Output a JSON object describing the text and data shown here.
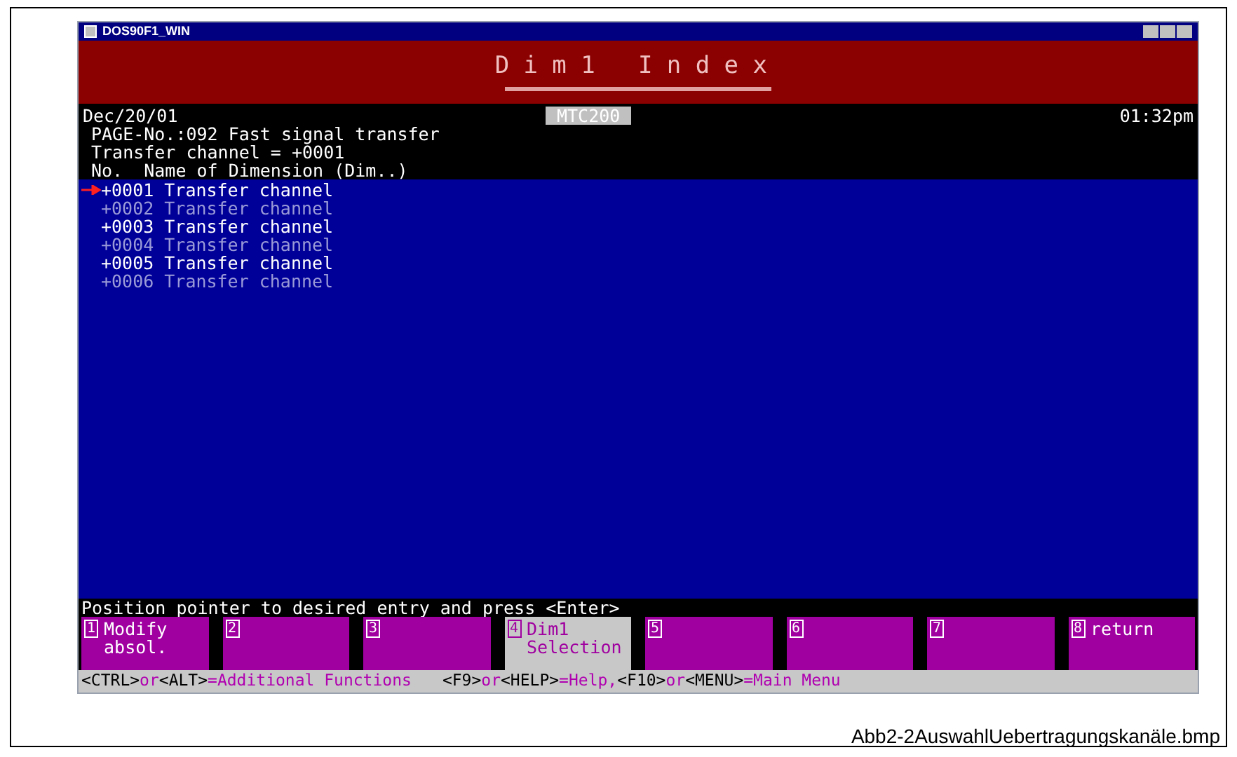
{
  "window": {
    "title": "DOS90F1_WIN"
  },
  "header": {
    "title": "Dim1 Index"
  },
  "info": {
    "date": "Dec/20/01",
    "badge": "MTC200",
    "time": "01:32pm",
    "lines": [
      "PAGE-No.:092 Fast signal transfer",
      "Transfer channel = +0001",
      "No.  Name of Dimension (Dim..)"
    ]
  },
  "rows": [
    {
      "text": "+0001 Transfer channel",
      "selected": true,
      "highlighted": true
    },
    {
      "text": "+0002 Transfer channel",
      "selected": false,
      "highlighted": false
    },
    {
      "text": "+0003 Transfer channel",
      "selected": false,
      "highlighted": true
    },
    {
      "text": "+0004 Transfer channel",
      "selected": false,
      "highlighted": false
    },
    {
      "text": "+0005 Transfer channel",
      "selected": false,
      "highlighted": true
    },
    {
      "text": "+0006 Transfer channel",
      "selected": false,
      "highlighted": false
    }
  ],
  "prompt": "Position pointer to desired entry and press <Enter>",
  "function_keys": [
    {
      "number": "1",
      "label": "Modify absol.",
      "active": false
    },
    {
      "number": "2",
      "active": false
    },
    {
      "number": "3",
      "active": false
    },
    {
      "number": "4",
      "label": "Dim1 Selection",
      "active": true
    },
    {
      "number": "5",
      "active": false
    },
    {
      "number": "6",
      "active": false
    },
    {
      "number": "7",
      "active": false
    },
    {
      "number": "8",
      "label": "return",
      "active": false
    }
  ],
  "hint_bar": [
    {
      "text": "<CTRL>",
      "kind": "key"
    },
    {
      "text": "or",
      "kind": "word"
    },
    {
      "text": "<ALT>",
      "kind": "key"
    },
    {
      "text": "=Additional Functions",
      "kind": "word"
    },
    {
      "text": "<F9>",
      "kind": "key"
    },
    {
      "text": "or",
      "kind": "word"
    },
    {
      "text": "<HELP>",
      "kind": "key"
    },
    {
      "text": "=Help,",
      "kind": "word"
    },
    {
      "text": "<F10>",
      "kind": "key"
    },
    {
      "text": "or",
      "kind": "word"
    },
    {
      "text": "<MENU>",
      "kind": "key"
    },
    {
      "text": "=Main Menu",
      "kind": "word"
    }
  ],
  "caption": "Abb2-2AuswahlUebertragungskanäle.bmp"
}
